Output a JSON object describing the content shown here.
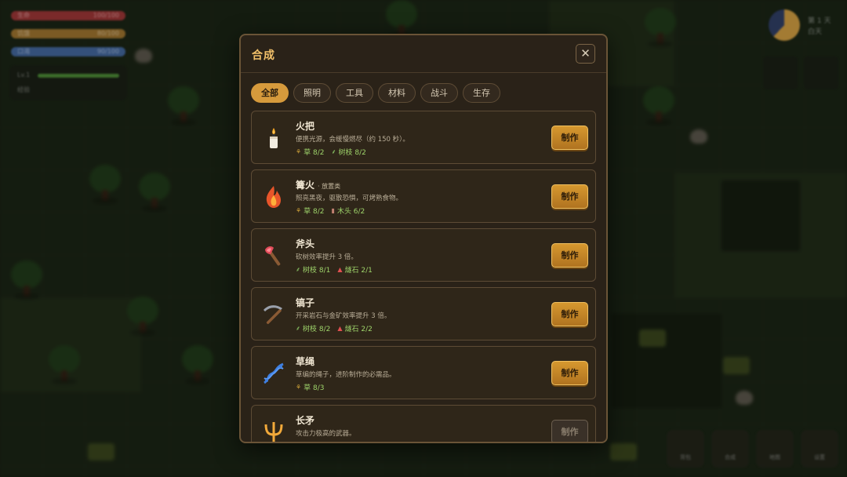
{
  "hud": {
    "hp_label": "生命",
    "hp_value": "100/100",
    "food_label": "饥饿",
    "food_value": "80/100",
    "water_label": "口渴",
    "water_value": "90/100",
    "level_label": "Lv.1",
    "xp_label": "经验",
    "clock_day": "第 1 天",
    "clock_time": "白天",
    "hotbar": [
      "背包",
      "合成",
      "地图",
      "设置"
    ]
  },
  "modal": {
    "title": "合成",
    "close_icon": "close-icon",
    "tabs": [
      "全部",
      "照明",
      "工具",
      "材料",
      "战斗",
      "生存"
    ],
    "active_tab": "全部",
    "craft_label": "制作",
    "recipes": [
      {
        "name": "火把",
        "tag": "",
        "desc": "便携光源，会缓慢燃尽（约 150 秒）。",
        "icon": "candle-icon",
        "mats": [
          {
            "icon": "grass-icon",
            "text": "草 8/2"
          },
          {
            "icon": "twig-icon",
            "text": "树枝 8/2"
          }
        ],
        "enabled": true
      },
      {
        "name": "篝火",
        "tag": "· 放置类",
        "desc": "照亮黑夜，驱散恐惧，可烤熟食物。",
        "icon": "fire-icon",
        "mats": [
          {
            "icon": "grass-icon",
            "text": "草 8/2"
          },
          {
            "icon": "wood-icon",
            "text": "木头 6/2"
          }
        ],
        "enabled": true
      },
      {
        "name": "斧头",
        "tag": "",
        "desc": "砍树效率提升 3 倍。",
        "icon": "axe-icon",
        "mats": [
          {
            "icon": "twig-icon",
            "text": "树枝 8/1"
          },
          {
            "icon": "flint-icon",
            "text": "燧石 2/1"
          }
        ],
        "enabled": true
      },
      {
        "name": "镐子",
        "tag": "",
        "desc": "开采岩石与金矿效率提升 3 倍。",
        "icon": "pickaxe-icon",
        "mats": [
          {
            "icon": "twig-icon",
            "text": "树枝 8/2"
          },
          {
            "icon": "flint-icon",
            "text": "燧石 2/2"
          }
        ],
        "enabled": true
      },
      {
        "name": "草绳",
        "tag": "",
        "desc": "草编的绳子，进阶制作的必需品。",
        "icon": "rope-icon",
        "mats": [
          {
            "icon": "grass-icon",
            "text": "草 8/3"
          }
        ],
        "enabled": true
      },
      {
        "name": "长矛",
        "tag": "",
        "desc": "攻击力极高的武器。",
        "icon": "spear-icon",
        "mats": [],
        "enabled": false
      }
    ]
  },
  "colors": {
    "accent": "#d69a3c",
    "title": "#f2c16a",
    "material": "#9ed36a"
  }
}
